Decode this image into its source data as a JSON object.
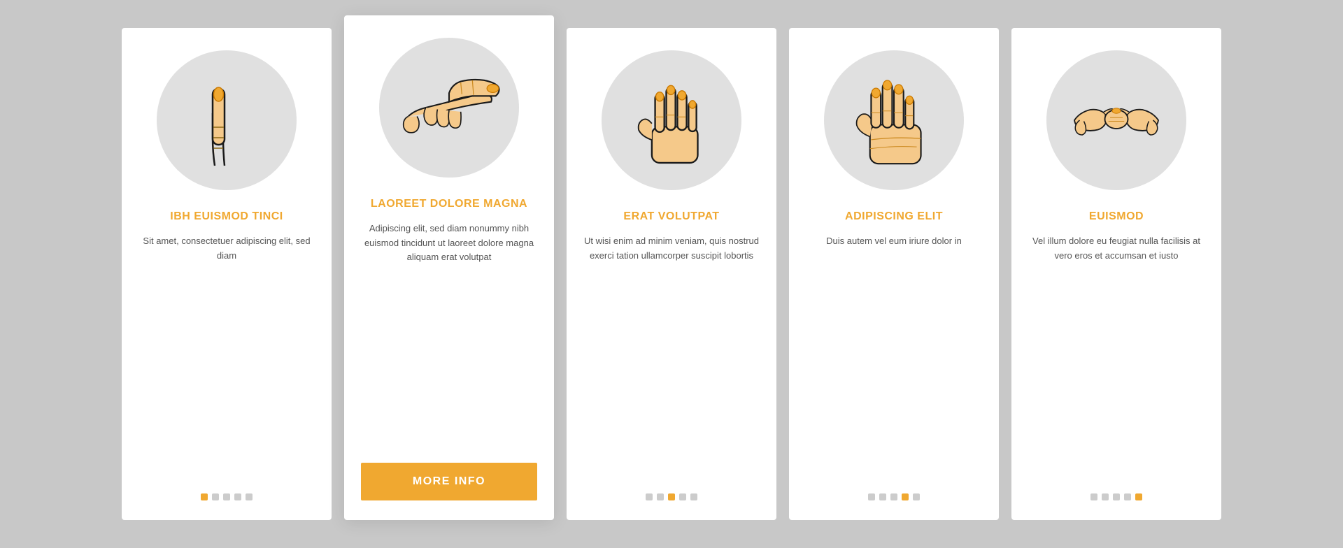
{
  "background_color": "#c8c8c8",
  "accent_color": "#f0a830",
  "cards": [
    {
      "id": "card-1",
      "highlighted": false,
      "icon": "finger",
      "title": "IBH EUISMOD TINCI",
      "text": "Sit amet, consectetuer adipiscing elit, sed diam",
      "dots": [
        true,
        false,
        false,
        false,
        false
      ],
      "button": null
    },
    {
      "id": "card-2",
      "highlighted": true,
      "icon": "pointing",
      "title": "LAOREET DOLORE MAGNA",
      "text": "Adipiscing elit, sed diam nonummy nibh euismod tincidunt ut laoreet dolore magna aliquam erat volutpat",
      "dots": null,
      "button": "MORE INFO"
    },
    {
      "id": "card-3",
      "highlighted": false,
      "icon": "open-hand",
      "title": "ERAT VOLUTPAT",
      "text": "Ut wisi enim ad minim veniam, quis nostrud exerci tation ullamcorper suscipit lobortis",
      "dots": [
        true,
        true,
        false,
        false,
        false
      ],
      "button": null
    },
    {
      "id": "card-4",
      "highlighted": false,
      "icon": "palm",
      "title": "ADIPISCING ELIT",
      "text": "Duis autem vel eum iriure dolor in",
      "dots": [
        true,
        true,
        true,
        false,
        false
      ],
      "button": null
    },
    {
      "id": "card-5",
      "highlighted": false,
      "icon": "handshake",
      "title": "EUISMOD",
      "text": "Vel illum dolore eu feugiat nulla facilisis at vero eros et accumsan et iusto",
      "dots": [
        true,
        true,
        true,
        true,
        false
      ],
      "button": null
    }
  ]
}
